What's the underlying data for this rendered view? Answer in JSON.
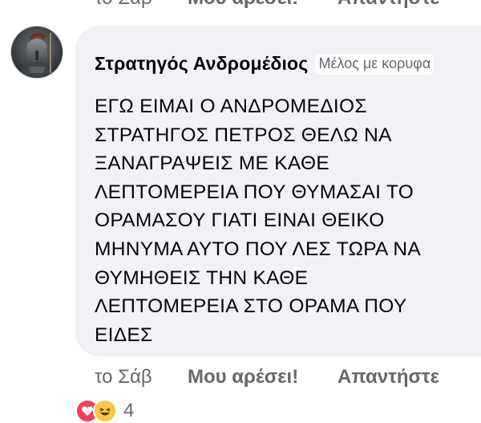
{
  "top_actions": {
    "timestamp": "το Σάβ",
    "like_label": "Μου αρέσει!",
    "reply_label": "Απαντήστε"
  },
  "comment": {
    "author": "Στρατηγός Ανδρομέδιος",
    "badge": "Μέλος με κορυφα",
    "text_lines": [
      "ΕΓΩ ΕΙΜΑΙ Ο ΑΝΔΡΟΜΕΔΙΟΣ",
      "ΣΤΡΑΤΗΓΟΣ ΠΕΤΡΟΣ ΘΕΛΩ ΝΑ",
      "ΞΑΝΑΓΡΑΨΕΙΣ ΜΕ ΚΑΘΕ",
      "ΛΕΠΤΟΜΕΡΕΙΑ ΠΟΥ ΘΥΜΑΣΑΙ ΤΟ",
      "ΟΡΑΜΑΣΟΥ ΓΙΑΤΙ ΕΙΝΑΙ ΘΕΙΚΟ",
      "ΜΗΝΥΜΑ ΑΥΤΟ ΠΟΥ ΛΕΣ ΤΩΡΑ ΝΑ",
      "ΘΥΜΗΘΕΙΣ ΤΗΝ ΚΑΘΕ",
      "ΛΕΠΤΟΜΕΡΕΙΑ ΣΤΟ ΟΡΑΜΑ ΠΟΥ",
      "ΕΙΔΕΣ"
    ],
    "avatar_icon": "warrior-avatar-icon"
  },
  "bottom_actions": {
    "timestamp": "το Σάβ",
    "like_label": "Μου αρέσει!",
    "reply_label": "Απαντήστε"
  },
  "reactions": {
    "icons": [
      "love-reaction-icon",
      "haha-reaction-icon"
    ],
    "count": "4"
  },
  "colors": {
    "bubble_bg": "#f0f2f5",
    "meta_text": "#65676b",
    "text": "#050505",
    "love": "#f33e58",
    "haha": "#f7c843"
  }
}
